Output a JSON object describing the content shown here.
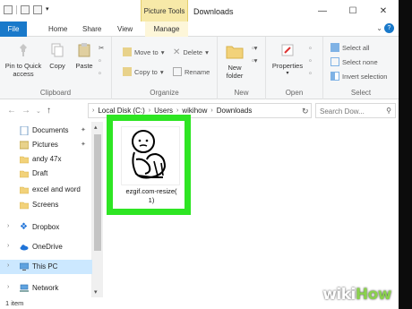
{
  "window": {
    "context_tab": "Picture Tools",
    "title": "Downloads",
    "controls": {
      "minimize": "—",
      "maximize": "☐",
      "close": "✕"
    }
  },
  "tabs": {
    "file": "File",
    "home": "Home",
    "share": "Share",
    "view": "View",
    "manage": "Manage",
    "help": "?"
  },
  "ribbon": {
    "clipboard": {
      "label": "Clipboard",
      "pin": "Pin to Quick access",
      "copy": "Copy",
      "paste": "Paste"
    },
    "organize": {
      "label": "Organize",
      "move_to": "Move to",
      "copy_to": "Copy to",
      "delete": "Delete",
      "rename": "Rename"
    },
    "new": {
      "label": "New",
      "new_folder": "New folder"
    },
    "open": {
      "label": "Open",
      "properties": "Properties"
    },
    "select": {
      "label": "Select",
      "select_all": "Select all",
      "select_none": "Select none",
      "invert": "Invert selection"
    }
  },
  "address": {
    "crumbs": [
      "Local Disk (C:)",
      "Users",
      "wikihow",
      "Downloads"
    ],
    "search_placeholder": "Search Dow..."
  },
  "sidebar": {
    "items": [
      {
        "label": "Documents",
        "pinned": true
      },
      {
        "label": "Pictures",
        "pinned": true
      },
      {
        "label": "andy 47x"
      },
      {
        "label": "Draft"
      },
      {
        "label": "excel and word"
      },
      {
        "label": "Screens"
      },
      {
        "label": "Dropbox"
      },
      {
        "label": "OneDrive"
      },
      {
        "label": "This PC"
      },
      {
        "label": "Network"
      }
    ]
  },
  "content": {
    "file_name": "ezgif.com-resize(1)",
    "file_name_line1": "ezgif.com-resize(",
    "file_name_line2": "1)"
  },
  "status": {
    "count": "1 item"
  },
  "watermark": {
    "wiki": "wiki",
    "how": "How"
  },
  "colors": {
    "file_tab": "#1979ca",
    "highlight": "#2ee523",
    "selected": "#cce8ff",
    "context_tab": "#f7e9a8"
  }
}
